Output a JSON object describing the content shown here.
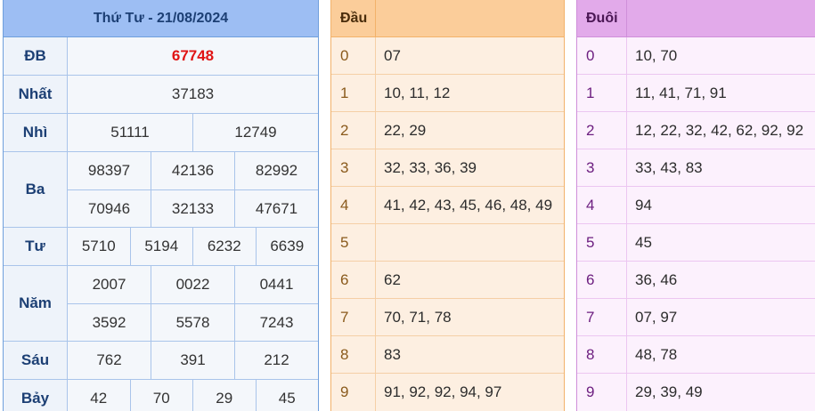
{
  "results": {
    "title": "Thứ Tư - 21/08/2024",
    "prizes": [
      {
        "label": "ĐB",
        "lines": [
          [
            "67748"
          ]
        ]
      },
      {
        "label": "Nhất",
        "lines": [
          [
            "37183"
          ]
        ]
      },
      {
        "label": "Nhì",
        "lines": [
          [
            "51111",
            "12749"
          ]
        ]
      },
      {
        "label": "Ba",
        "lines": [
          [
            "98397",
            "42136",
            "82992"
          ],
          [
            "70946",
            "32133",
            "47671"
          ]
        ]
      },
      {
        "label": "Tư",
        "lines": [
          [
            "5710",
            "5194",
            "6232",
            "6639"
          ]
        ]
      },
      {
        "label": "Năm",
        "lines": [
          [
            "2007",
            "0022",
            "0441"
          ],
          [
            "3592",
            "5578",
            "7243"
          ]
        ]
      },
      {
        "label": "Sáu",
        "lines": [
          [
            "762",
            "391",
            "212"
          ]
        ]
      },
      {
        "label": "Bảy",
        "lines": [
          [
            "42",
            "70",
            "29",
            "45"
          ]
        ]
      }
    ]
  },
  "dau": {
    "header": "Đầu",
    "rows": [
      {
        "digit": "0",
        "values": "07"
      },
      {
        "digit": "1",
        "values": "10, 11, 12"
      },
      {
        "digit": "2",
        "values": "22, 29"
      },
      {
        "digit": "3",
        "values": "32, 33, 36, 39"
      },
      {
        "digit": "4",
        "values": "41, 42, 43, 45, 46, 48, 49"
      },
      {
        "digit": "5",
        "values": ""
      },
      {
        "digit": "6",
        "values": "62"
      },
      {
        "digit": "7",
        "values": "70, 71, 78"
      },
      {
        "digit": "8",
        "values": "83"
      },
      {
        "digit": "9",
        "values": "91, 92, 92, 94, 97"
      }
    ]
  },
  "duoi": {
    "header": "Đuôi",
    "rows": [
      {
        "digit": "0",
        "values": "10, 70"
      },
      {
        "digit": "1",
        "values": "11, 41, 71, 91"
      },
      {
        "digit": "2",
        "values": "12, 22, 32, 42, 62, 92, 92"
      },
      {
        "digit": "3",
        "values": "33, 43, 83"
      },
      {
        "digit": "4",
        "values": "94"
      },
      {
        "digit": "5",
        "values": "45"
      },
      {
        "digit": "6",
        "values": "36, 46"
      },
      {
        "digit": "7",
        "values": "07, 97"
      },
      {
        "digit": "8",
        "values": "48, 78"
      },
      {
        "digit": "9",
        "values": "29, 39, 49"
      }
    ]
  },
  "colors": {
    "special_prize": "#e01414",
    "results_header": "#9dbef3",
    "dau_header": "#fbcd9a",
    "duoi_header": "#e2aaea"
  }
}
